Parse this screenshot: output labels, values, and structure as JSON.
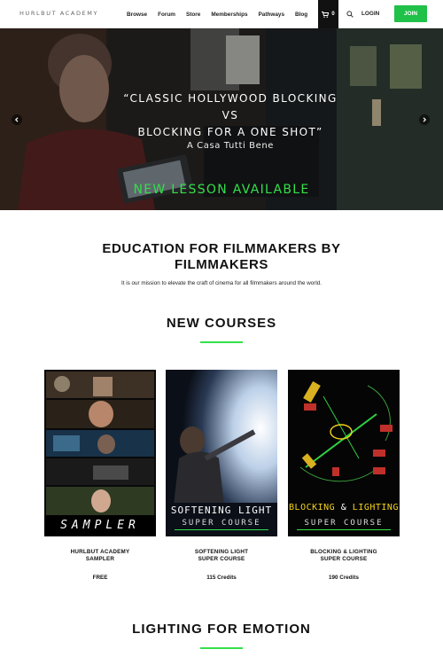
{
  "header": {
    "logo": "HURLBUT ACADEMY",
    "nav": [
      "Browse",
      "Forum",
      "Store",
      "Memberships",
      "Pathways",
      "Blog"
    ],
    "cart_count": "0",
    "login": "LOGIN",
    "join": "JOIN"
  },
  "hero": {
    "line1": "“CLASSIC HOLLYWOOD BLOCKING",
    "line2": "VS",
    "line3": "BLOCKING FOR A ONE SHOT”",
    "subtitle": "A Casa Tutti Bene",
    "cta": "NEW LESSON AVAILABLE"
  },
  "intro": {
    "title": "EDUCATION FOR FILMMAKERS BY FILMMAKERS",
    "text": "It is our mission to elevate the craft of cinema for all filmmakers around the world."
  },
  "new_courses": {
    "title": "NEW COURSES",
    "courses": [
      {
        "poster_title": "SAMPLER",
        "name_line1": "HURLBUT ACADEMY",
        "name_line2": "SAMPLER",
        "price": "FREE"
      },
      {
        "poster_title": "SOFTENING LIGHT",
        "poster_sub": "SUPER COURSE",
        "name_line1": "SOFTENING LIGHT",
        "name_line2": "SUPER COURSE",
        "price": "115 Credits"
      },
      {
        "poster_title_a": "BLOCKING",
        "poster_title_b": "&",
        "poster_title_c": "LIGHTING",
        "poster_sub": "SUPER COURSE",
        "name_line1": "BLOCKING & LIGHTING",
        "name_line2": "SUPER COURSE",
        "price": "190 Credits"
      }
    ]
  },
  "lighting": {
    "title": "LIGHTING FOR EMOTION"
  },
  "colors": {
    "accent_green": "#1fc148",
    "cta_green": "#33e04a",
    "poster_yellow": "#f4d21d"
  }
}
